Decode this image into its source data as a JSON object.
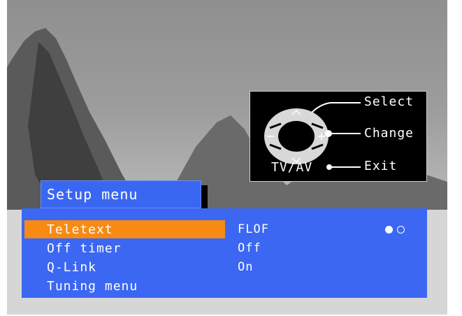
{
  "help_panel": {
    "select_label": "Select",
    "change_label": "Change",
    "exit_label": "Exit",
    "tvav_label": "TV/AV"
  },
  "menu": {
    "title": "Setup menu",
    "items": [
      {
        "label": "Teletext",
        "value": "FLOF",
        "selected": true
      },
      {
        "label": "Off timer",
        "value": "Off"
      },
      {
        "label": "Q-Link",
        "value": "On"
      },
      {
        "label": "Tuning menu",
        "value": ""
      }
    ],
    "option_dots": [
      "filled",
      "empty"
    ]
  },
  "colors": {
    "menu_blue": "#3b67f2",
    "highlight_orange": "#f78a14",
    "text": "#ffffff",
    "help_bg": "#000000"
  },
  "icons": [
    "navigation-pad-icon",
    "up-arrow-icon",
    "down-arrow-icon",
    "minus-icon",
    "plus-icon",
    "tvav-button-icon"
  ]
}
